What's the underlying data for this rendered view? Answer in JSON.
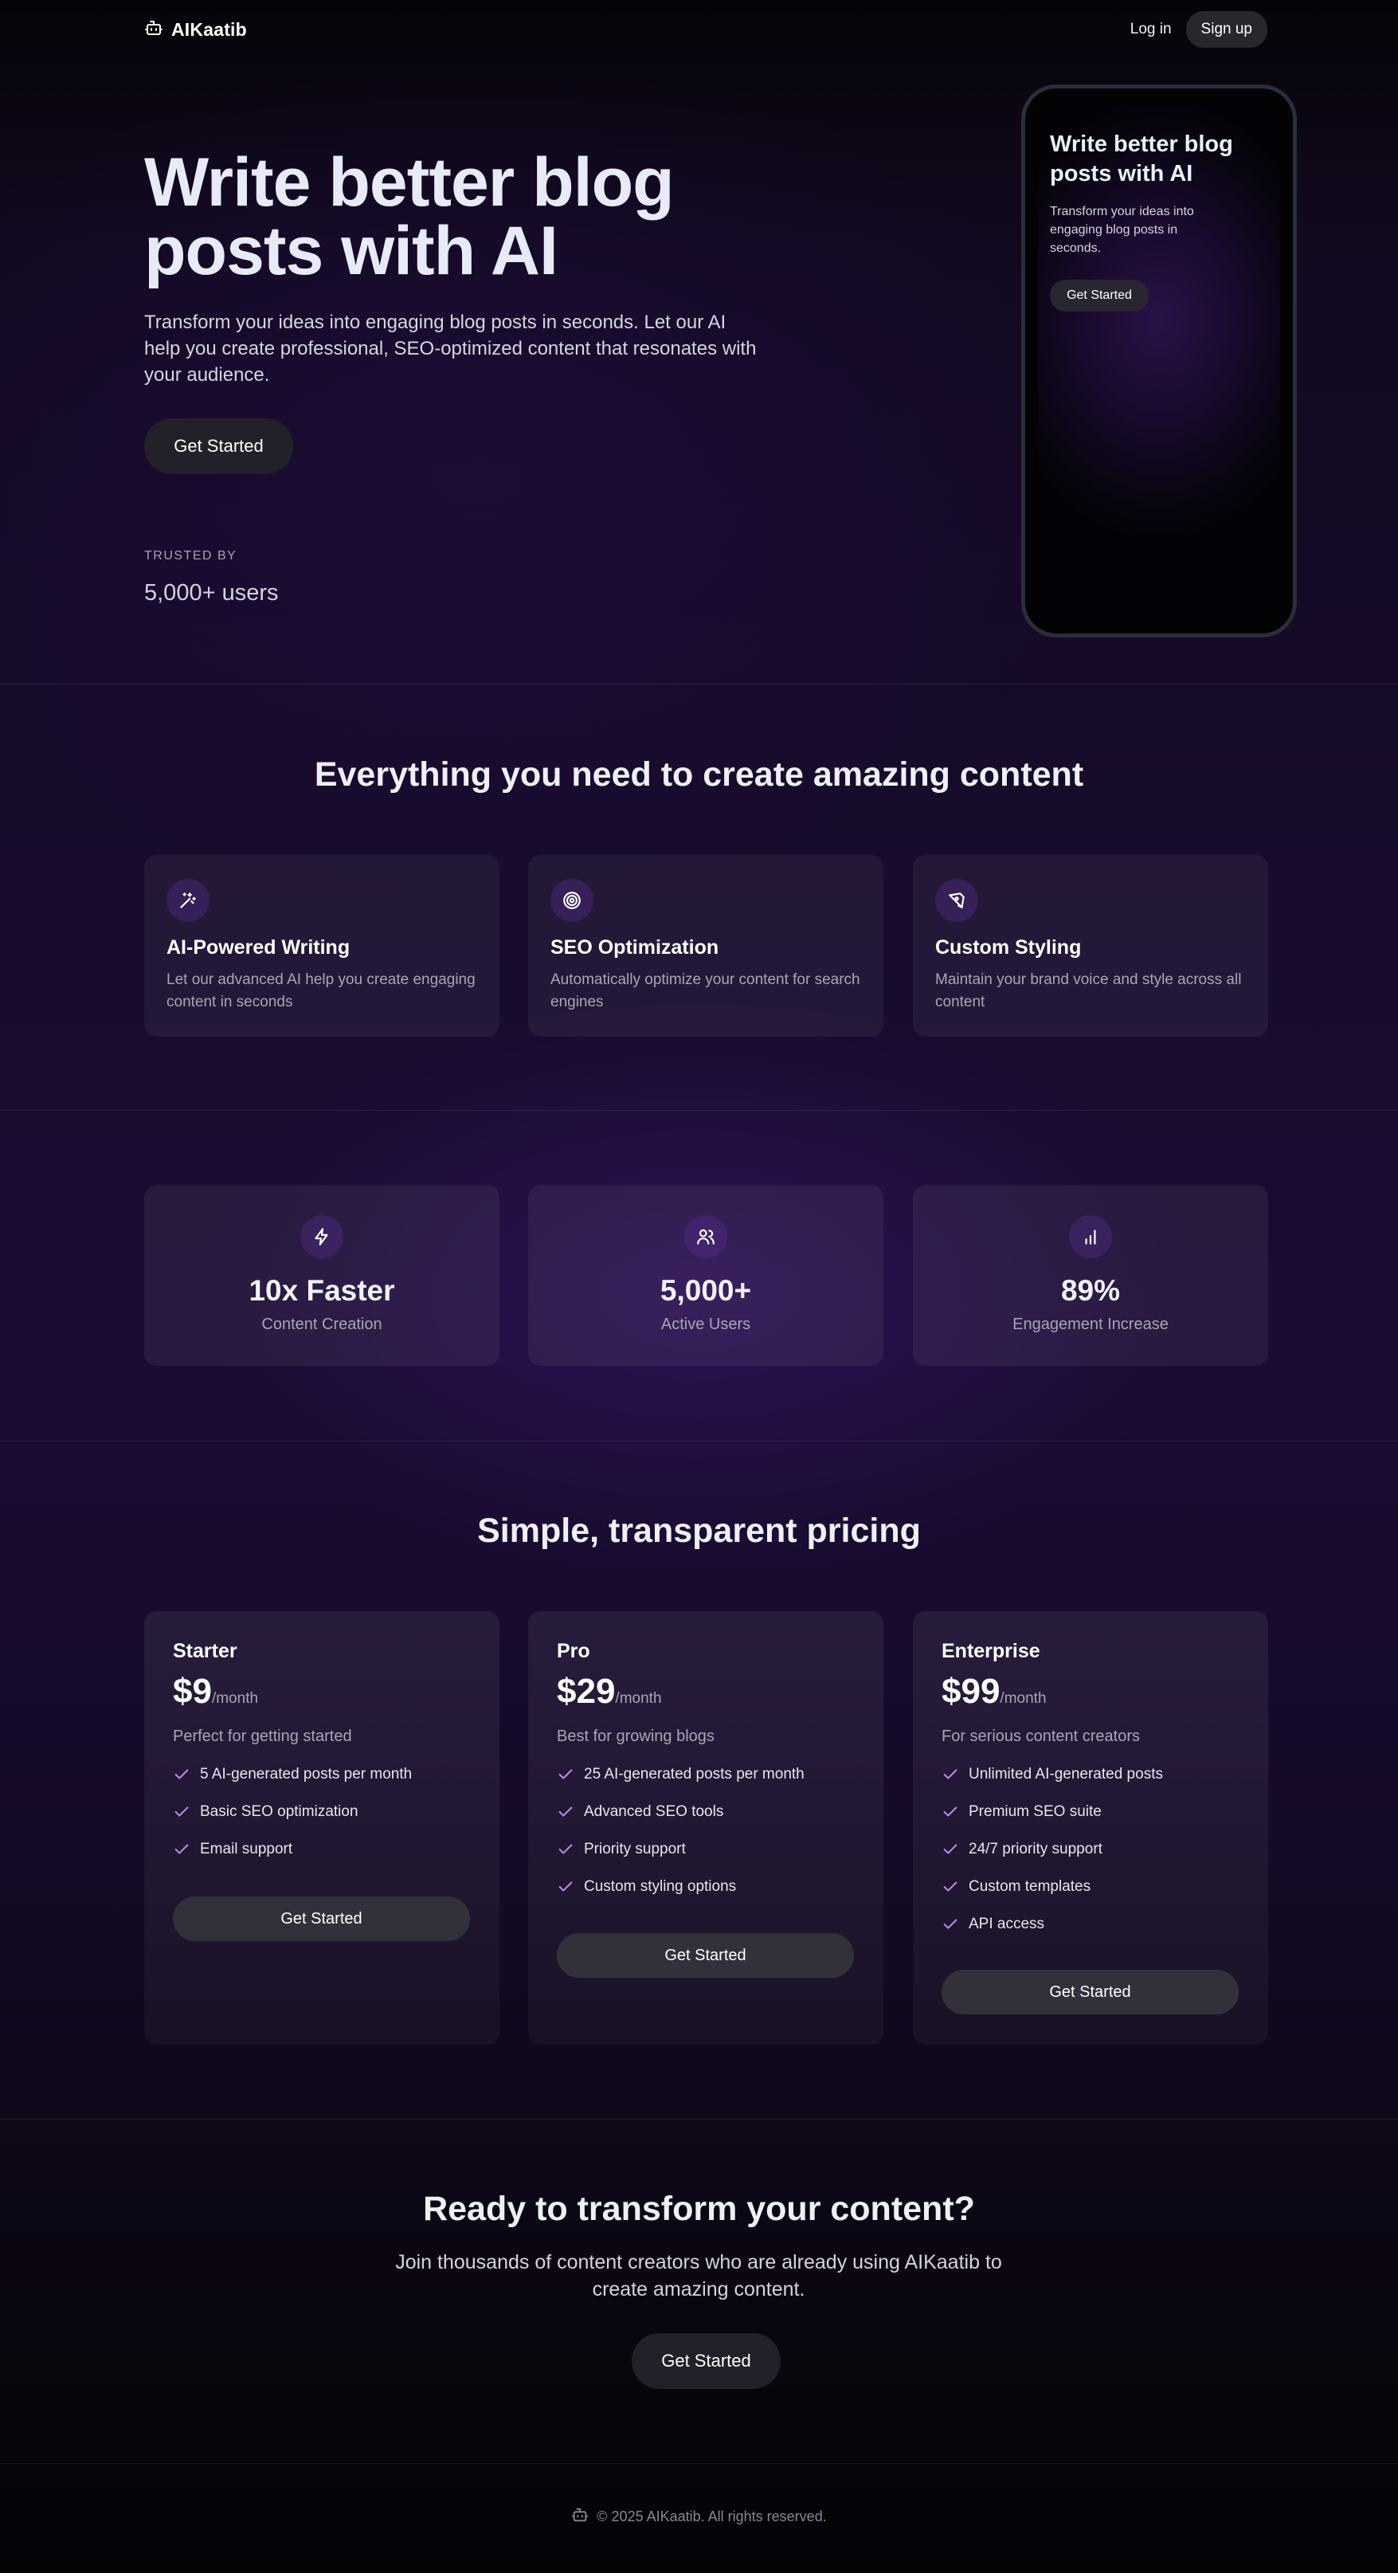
{
  "nav": {
    "brand": "AIKaatib",
    "login": "Log in",
    "signup": "Sign up"
  },
  "hero": {
    "title": "Write better blog posts with AI",
    "subtitle": "Transform your ideas into engaging blog posts in seconds. Let our AI help you create professional, SEO-optimized content that resonates with your audience.",
    "cta": "Get Started",
    "trusted_label": "TRUSTED BY",
    "trusted_value": "5,000+ users"
  },
  "phone": {
    "title": "Write better blog posts with AI",
    "subtitle": "Transform your ideas into engaging blog posts in seconds.",
    "cta": "Get Started"
  },
  "features": {
    "title": "Everything you need to create amazing content",
    "items": [
      {
        "icon": "sparkles-icon",
        "title": "AI-Powered Writing",
        "desc": "Let our advanced AI help you create engaging content in seconds"
      },
      {
        "icon": "target-icon",
        "title": "SEO Optimization",
        "desc": "Automatically optimize your content for search engines"
      },
      {
        "icon": "pen-tool-icon",
        "title": "Custom Styling",
        "desc": "Maintain your brand voice and style across all content"
      }
    ]
  },
  "stats": [
    {
      "icon": "bolt-icon",
      "value": "10x Faster",
      "label": "Content Creation"
    },
    {
      "icon": "users-icon",
      "value": "5,000+",
      "label": "Active Users"
    },
    {
      "icon": "bar-chart-icon",
      "value": "89%",
      "label": "Engagement Increase"
    }
  ],
  "pricing": {
    "title": "Simple, transparent pricing",
    "plans": [
      {
        "name": "Starter",
        "price": "$9",
        "period": "/month",
        "desc": "Perfect for getting started",
        "features": [
          "5 AI-generated posts per month",
          "Basic SEO optimization",
          "Email support"
        ],
        "cta": "Get Started"
      },
      {
        "name": "Pro",
        "price": "$29",
        "period": "/month",
        "desc": "Best for growing blogs",
        "features": [
          "25 AI-generated posts per month",
          "Advanced SEO tools",
          "Priority support",
          "Custom styling options"
        ],
        "cta": "Get Started"
      },
      {
        "name": "Enterprise",
        "price": "$99",
        "period": "/month",
        "desc": "For serious content creators",
        "features": [
          "Unlimited AI-generated posts",
          "Premium SEO suite",
          "24/7 priority support",
          "Custom templates",
          "API access"
        ],
        "cta": "Get Started"
      }
    ]
  },
  "cta": {
    "title": "Ready to transform your content?",
    "subtitle": "Join thousands of content creators who are already using AIKaatib to create amazing content.",
    "button": "Get Started"
  },
  "footer": {
    "text": "© 2025 AIKaatib. All rights reserved."
  },
  "colors": {
    "accent": "#b78cf0",
    "button": "#242029",
    "background": "#07050b"
  }
}
